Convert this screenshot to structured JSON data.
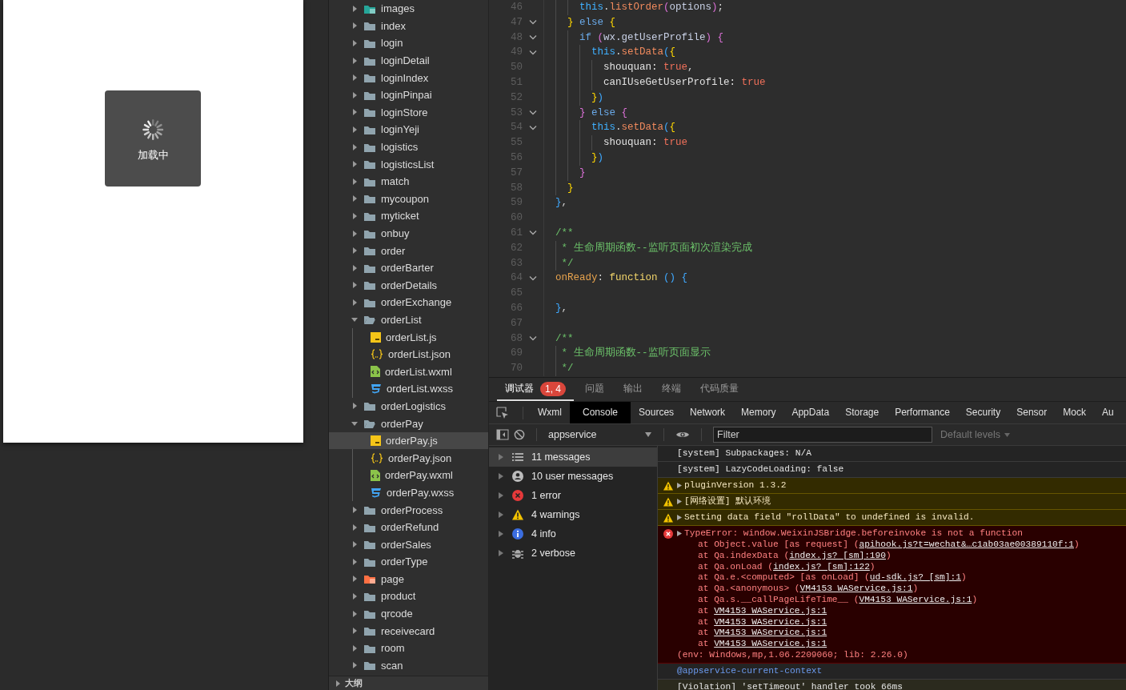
{
  "simulator": {
    "toast": {
      "text": "加载中"
    }
  },
  "file_tree": {
    "items": [
      {
        "name": "images",
        "kind": "images",
        "expanded": false,
        "selected": false
      },
      {
        "name": "index",
        "kind": "folder",
        "expanded": false,
        "selected": false
      },
      {
        "name": "login",
        "kind": "folder",
        "expanded": false,
        "selected": false
      },
      {
        "name": "loginDetail",
        "kind": "folder",
        "expanded": false,
        "selected": false
      },
      {
        "name": "loginIndex",
        "kind": "folder",
        "expanded": false,
        "selected": false
      },
      {
        "name": "loginPinpai",
        "kind": "folder",
        "expanded": false,
        "selected": false
      },
      {
        "name": "loginStore",
        "kind": "folder",
        "expanded": false,
        "selected": false
      },
      {
        "name": "loginYeji",
        "kind": "folder",
        "expanded": false,
        "selected": false
      },
      {
        "name": "logistics",
        "kind": "folder",
        "expanded": false,
        "selected": false
      },
      {
        "name": "logisticsList",
        "kind": "folder",
        "expanded": false,
        "selected": false
      },
      {
        "name": "match",
        "kind": "folder",
        "expanded": false,
        "selected": false
      },
      {
        "name": "mycoupon",
        "kind": "folder",
        "expanded": false,
        "selected": false
      },
      {
        "name": "myticket",
        "kind": "folder",
        "expanded": false,
        "selected": false
      },
      {
        "name": "onbuy",
        "kind": "folder",
        "expanded": false,
        "selected": false
      },
      {
        "name": "order",
        "kind": "folder",
        "expanded": false,
        "selected": false
      },
      {
        "name": "orderBarter",
        "kind": "folder",
        "expanded": false,
        "selected": false
      },
      {
        "name": "orderDetails",
        "kind": "folder",
        "expanded": false,
        "selected": false
      },
      {
        "name": "orderExchange",
        "kind": "folder",
        "expanded": false,
        "selected": false
      },
      {
        "name": "orderList",
        "kind": "folder",
        "expanded": true,
        "selected": false,
        "children": [
          {
            "name": "orderList.js",
            "kind": "js",
            "selected": false
          },
          {
            "name": "orderList.json",
            "kind": "json",
            "selected": false
          },
          {
            "name": "orderList.wxml",
            "kind": "wxml",
            "selected": false
          },
          {
            "name": "orderList.wxss",
            "kind": "wxss",
            "selected": false
          }
        ]
      },
      {
        "name": "orderLogistics",
        "kind": "folder",
        "expanded": false,
        "selected": false
      },
      {
        "name": "orderPay",
        "kind": "folder",
        "expanded": true,
        "selected": false,
        "children": [
          {
            "name": "orderPay.js",
            "kind": "js",
            "selected": true
          },
          {
            "name": "orderPay.json",
            "kind": "json",
            "selected": false
          },
          {
            "name": "orderPay.wxml",
            "kind": "wxml",
            "selected": false
          },
          {
            "name": "orderPay.wxss",
            "kind": "wxss",
            "selected": false
          }
        ]
      },
      {
        "name": "orderProcess",
        "kind": "folder",
        "expanded": false,
        "selected": false
      },
      {
        "name": "orderRefund",
        "kind": "folder",
        "expanded": false,
        "selected": false
      },
      {
        "name": "orderSales",
        "kind": "folder",
        "expanded": false,
        "selected": false
      },
      {
        "name": "orderType",
        "kind": "folder",
        "expanded": false,
        "selected": false
      },
      {
        "name": "page",
        "kind": "page",
        "expanded": false,
        "selected": false
      },
      {
        "name": "product",
        "kind": "folder",
        "expanded": false,
        "selected": false
      },
      {
        "name": "qrcode",
        "kind": "folder",
        "expanded": false,
        "selected": false
      },
      {
        "name": "receivecard",
        "kind": "folder",
        "expanded": false,
        "selected": false
      },
      {
        "name": "room",
        "kind": "folder",
        "expanded": false,
        "selected": false
      },
      {
        "name": "scan",
        "kind": "folder",
        "expanded": false,
        "selected": false
      }
    ],
    "outline": {
      "label": "大纲",
      "expanded": false
    }
  },
  "editor": {
    "lines": [
      {
        "number": "46",
        "fold": false,
        "tokens": [
          {
            "text": "    this",
            "kind": "this"
          },
          {
            "text": ".",
            "kind": "punc"
          },
          {
            "text": "listOrder",
            "kind": "fn"
          },
          {
            "text": "(",
            "kind": "b2"
          },
          {
            "text": "options",
            "kind": "var"
          },
          {
            "text": ")",
            "kind": "b2"
          },
          {
            "text": ";",
            "kind": "punc"
          }
        ]
      },
      {
        "number": "47",
        "fold": true,
        "tokens": [
          {
            "text": "  }",
            "kind": "b1"
          },
          {
            "text": " else ",
            "kind": "kw"
          },
          {
            "text": "{",
            "kind": "b1"
          }
        ]
      },
      {
        "number": "48",
        "fold": true,
        "tokens": [
          {
            "text": "    if ",
            "kind": "kw"
          },
          {
            "text": "(",
            "kind": "b2"
          },
          {
            "text": "wx.getUserProfile",
            "kind": "var"
          },
          {
            "text": ")",
            "kind": "b2"
          },
          {
            "text": " {",
            "kind": "b2"
          }
        ]
      },
      {
        "number": "49",
        "fold": true,
        "tokens": [
          {
            "text": "      this",
            "kind": "this"
          },
          {
            "text": ".",
            "kind": "punc"
          },
          {
            "text": "setData",
            "kind": "fn"
          },
          {
            "text": "(",
            "kind": "b3"
          },
          {
            "text": "{",
            "kind": "b1"
          }
        ]
      },
      {
        "number": "50",
        "fold": false,
        "tokens": [
          {
            "text": "        shouquan: ",
            "kind": "prop"
          },
          {
            "text": "true",
            "kind": "bool"
          },
          {
            "text": ",",
            "kind": "punc"
          }
        ]
      },
      {
        "number": "51",
        "fold": false,
        "tokens": [
          {
            "text": "        canIUseGetUserProfile: ",
            "kind": "prop"
          },
          {
            "text": "true",
            "kind": "bool"
          }
        ]
      },
      {
        "number": "52",
        "fold": false,
        "tokens": [
          {
            "text": "      }",
            "kind": "b1"
          },
          {
            "text": ")",
            "kind": "b3"
          }
        ]
      },
      {
        "number": "53",
        "fold": true,
        "tokens": [
          {
            "text": "    }",
            "kind": "b2"
          },
          {
            "text": " else ",
            "kind": "kw"
          },
          {
            "text": "{",
            "kind": "b2"
          }
        ]
      },
      {
        "number": "54",
        "fold": true,
        "tokens": [
          {
            "text": "      this",
            "kind": "this"
          },
          {
            "text": ".",
            "kind": "punc"
          },
          {
            "text": "setData",
            "kind": "fn"
          },
          {
            "text": "(",
            "kind": "b3"
          },
          {
            "text": "{",
            "kind": "b1"
          }
        ]
      },
      {
        "number": "55",
        "fold": false,
        "tokens": [
          {
            "text": "        shouquan: ",
            "kind": "prop"
          },
          {
            "text": "true",
            "kind": "bool"
          }
        ]
      },
      {
        "number": "56",
        "fold": false,
        "tokens": [
          {
            "text": "      }",
            "kind": "b1"
          },
          {
            "text": ")",
            "kind": "b3"
          }
        ]
      },
      {
        "number": "57",
        "fold": false,
        "tokens": [
          {
            "text": "    }",
            "kind": "b2"
          }
        ]
      },
      {
        "number": "58",
        "fold": false,
        "tokens": [
          {
            "text": "  }",
            "kind": "b1"
          }
        ]
      },
      {
        "number": "59",
        "fold": false,
        "tokens": [
          {
            "text": "}",
            "kind": "b3"
          },
          {
            "text": ",",
            "kind": "punc"
          }
        ]
      },
      {
        "number": "60",
        "fold": false
      },
      {
        "number": "61",
        "fold": true,
        "tokens": [
          {
            "text": "/**",
            "kind": "cmt"
          }
        ]
      },
      {
        "number": "62",
        "fold": false,
        "tokens": [
          {
            "text": " * 生命周期函数--监听页面初次渲染完成",
            "kind": "cmt"
          }
        ]
      },
      {
        "number": "63",
        "fold": false,
        "tokens": [
          {
            "text": " */",
            "kind": "cmt"
          }
        ]
      },
      {
        "number": "64",
        "fold": true,
        "tokens": [
          {
            "text": "onReady",
            "kind": "key"
          },
          {
            "text": ": ",
            "kind": "punc"
          },
          {
            "text": "function",
            "kind": "func"
          },
          {
            "text": " ()",
            "kind": "b3"
          },
          {
            "text": " {",
            "kind": "b3"
          }
        ]
      },
      {
        "number": "65",
        "fold": false
      },
      {
        "number": "66",
        "fold": false,
        "tokens": [
          {
            "text": "}",
            "kind": "b3"
          },
          {
            "text": ",",
            "kind": "punc"
          }
        ]
      },
      {
        "number": "67",
        "fold": false
      },
      {
        "number": "68",
        "fold": true,
        "tokens": [
          {
            "text": "/**",
            "kind": "cmt"
          }
        ]
      },
      {
        "number": "69",
        "fold": false,
        "tokens": [
          {
            "text": " * 生命周期函数--监听页面显示",
            "kind": "cmt"
          }
        ]
      },
      {
        "number": "70",
        "fold": false,
        "tokens": [
          {
            "text": " */",
            "kind": "cmt"
          }
        ]
      }
    ]
  },
  "panel": {
    "tabs": [
      {
        "label": "调试器",
        "selected": true,
        "badge": "1, 4"
      },
      {
        "label": "问题",
        "selected": false
      },
      {
        "label": "输出",
        "selected": false
      },
      {
        "label": "终端",
        "selected": false
      },
      {
        "label": "代码质量",
        "selected": false
      }
    ],
    "devtools_tabs": [
      {
        "label": "Wxml",
        "selected": false
      },
      {
        "label": "Console",
        "selected": true
      },
      {
        "label": "Sources",
        "selected": false
      },
      {
        "label": "Network",
        "selected": false
      },
      {
        "label": "Memory",
        "selected": false
      },
      {
        "label": "AppData",
        "selected": false
      },
      {
        "label": "Storage",
        "selected": false
      },
      {
        "label": "Performance",
        "selected": false
      },
      {
        "label": "Security",
        "selected": false
      },
      {
        "label": "Sensor",
        "selected": false
      },
      {
        "label": "Mock",
        "selected": false
      },
      {
        "label": "Au",
        "selected": false
      }
    ],
    "toolbar": {
      "context": "appservice",
      "filter_placeholder": "Filter",
      "levels": "Default levels"
    },
    "sidebar": [
      {
        "label": "11 messages",
        "kind": "all",
        "selected": true
      },
      {
        "label": "10 user messages",
        "kind": "user",
        "selected": false
      },
      {
        "label": "1 error",
        "kind": "error",
        "selected": false
      },
      {
        "label": "4 warnings",
        "kind": "warning",
        "selected": false
      },
      {
        "label": "4 info",
        "kind": "info",
        "selected": false
      },
      {
        "label": "2 verbose",
        "kind": "verbose",
        "selected": false
      }
    ],
    "messages": [
      {
        "kind": "system",
        "text": "[system] Subpackages: N/A"
      },
      {
        "kind": "system",
        "text": "[system] LazyCodeLoading: false"
      },
      {
        "kind": "warning",
        "expandable": true,
        "text": "pluginVersion 1.3.2"
      },
      {
        "kind": "warning",
        "expandable": true,
        "text": "[网络设置] 默认环境"
      },
      {
        "kind": "warning",
        "expandable": true,
        "text": "Setting data field \"rollData\" to undefined is invalid."
      },
      {
        "kind": "error",
        "expandable": true,
        "text": "TypeError: window.WeixinJSBridge.beforeinvoke is not a function",
        "stack": [
          [
            {
              "text": "at Object.value [as request] (",
              "link": false
            },
            {
              "text": "apihook.js?t=wechat&…c1ab03ae00389110f:1",
              "link": true
            },
            {
              "text": ")",
              "link": false
            }
          ],
          [
            {
              "text": "at Qa.indexData (",
              "link": false
            },
            {
              "text": "index.js? [sm]:190",
              "link": true
            },
            {
              "text": ")",
              "link": false
            }
          ],
          [
            {
              "text": "at Qa.onLoad (",
              "link": false
            },
            {
              "text": "index.js? [sm]:122",
              "link": true
            },
            {
              "text": ")",
              "link": false
            }
          ],
          [
            {
              "text": "at Qa.e.<computed> [as onLoad] (",
              "link": false
            },
            {
              "text": "ud-sdk.js? [sm]:1",
              "link": true
            },
            {
              "text": ")",
              "link": false
            }
          ],
          [
            {
              "text": "at Qa.<anonymous> (",
              "link": false
            },
            {
              "text": "VM4153 WAService.js:1",
              "link": true
            },
            {
              "text": ")",
              "link": false
            }
          ],
          [
            {
              "text": "at Qa.s.__callPageLifeTime__ (",
              "link": false
            },
            {
              "text": "VM4153 WAService.js:1",
              "link": true
            },
            {
              "text": ")",
              "link": false
            }
          ],
          [
            {
              "text": "at ",
              "link": false
            },
            {
              "text": "VM4153 WAService.js:1",
              "link": true
            }
          ],
          [
            {
              "text": "at ",
              "link": false
            },
            {
              "text": "VM4153 WAService.js:1",
              "link": true
            }
          ],
          [
            {
              "text": "at ",
              "link": false
            },
            {
              "text": "VM4153 WAService.js:1",
              "link": true
            }
          ],
          [
            {
              "text": "at ",
              "link": false
            },
            {
              "text": "VM4153 WAService.js:1",
              "link": true
            }
          ]
        ],
        "footer": "(env: Windows,mp,1.06.2209060; lib: 2.26.0)"
      },
      {
        "kind": "context",
        "text": "@appservice-current-context"
      },
      {
        "kind": "violation",
        "text": "[Violation] 'setTimeout' handler took 66ms"
      }
    ]
  }
}
